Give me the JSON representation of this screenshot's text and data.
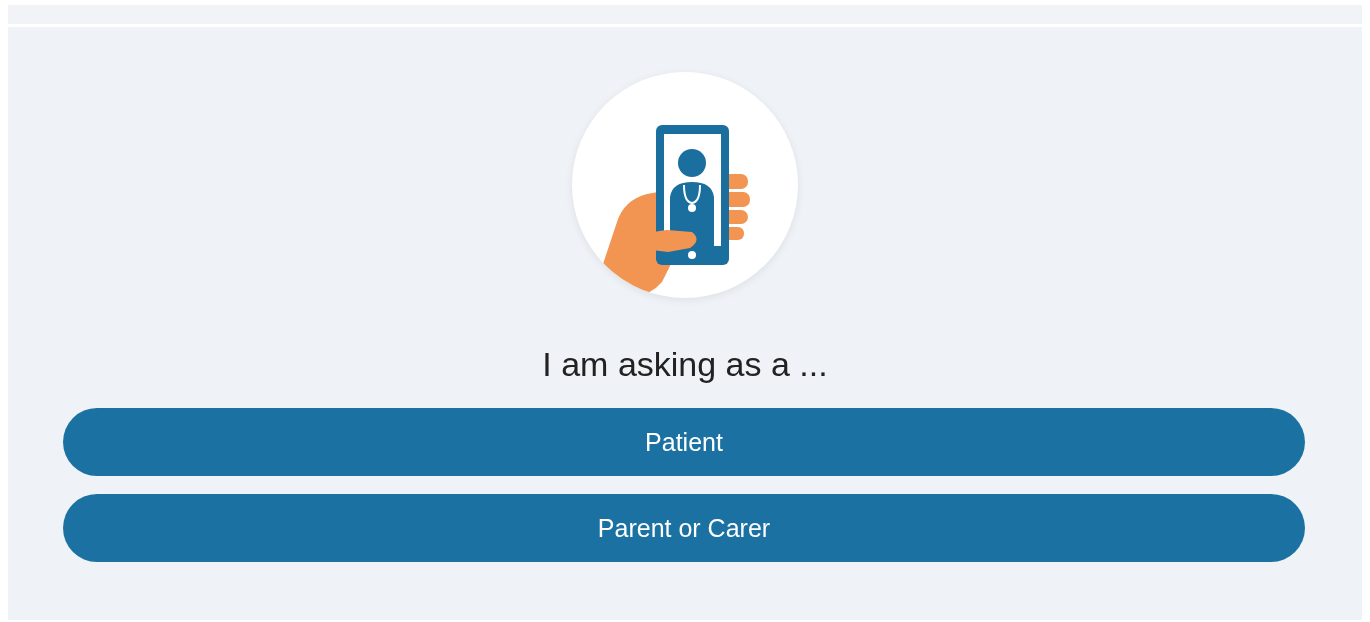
{
  "prompt": "I am asking as a ...",
  "options": [
    {
      "label": "Patient"
    },
    {
      "label": "Parent or Carer"
    }
  ]
}
